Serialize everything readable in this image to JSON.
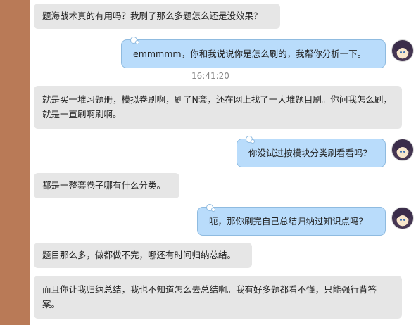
{
  "chat": {
    "messages": [
      {
        "side": "left",
        "text": "题海战术真的有用吗？我刷了那么多题怎么还是没效果？"
      },
      {
        "side": "right",
        "text": "emmmmm，你和我说说你是怎么刷的，我帮你分析一下。"
      },
      {
        "side": "left",
        "text": "就是买一堆习题册，模拟卷刷啊，刷了N套，还在网上找了一大堆题目刷。你问我怎么刷，就是一直刷啊刷啊。"
      },
      {
        "side": "right",
        "text": "你没试过按模块分类刷看看吗？"
      },
      {
        "side": "left",
        "text": "都是一整套卷子哪有什么分类。"
      },
      {
        "side": "right",
        "text": "呃，那你刷完自己总结归纳过知识点吗？"
      },
      {
        "side": "left",
        "text": "题目那么多，做都做不完，哪还有时间归纳总结。"
      },
      {
        "side": "left",
        "text": "而且你让我归纳总结，我也不知道怎么去总结啊。我有好多题都看不懂，只能强行背答案。"
      }
    ],
    "timestamp": "16:41:20"
  },
  "colors": {
    "sidebar": "#b97a57",
    "incoming_bubble": "#e6e6e6",
    "outgoing_bubble": "#b9dcfb",
    "outgoing_border": "#8fbbe0"
  },
  "icons": {
    "avatar": "user-avatar-anime-girl"
  }
}
